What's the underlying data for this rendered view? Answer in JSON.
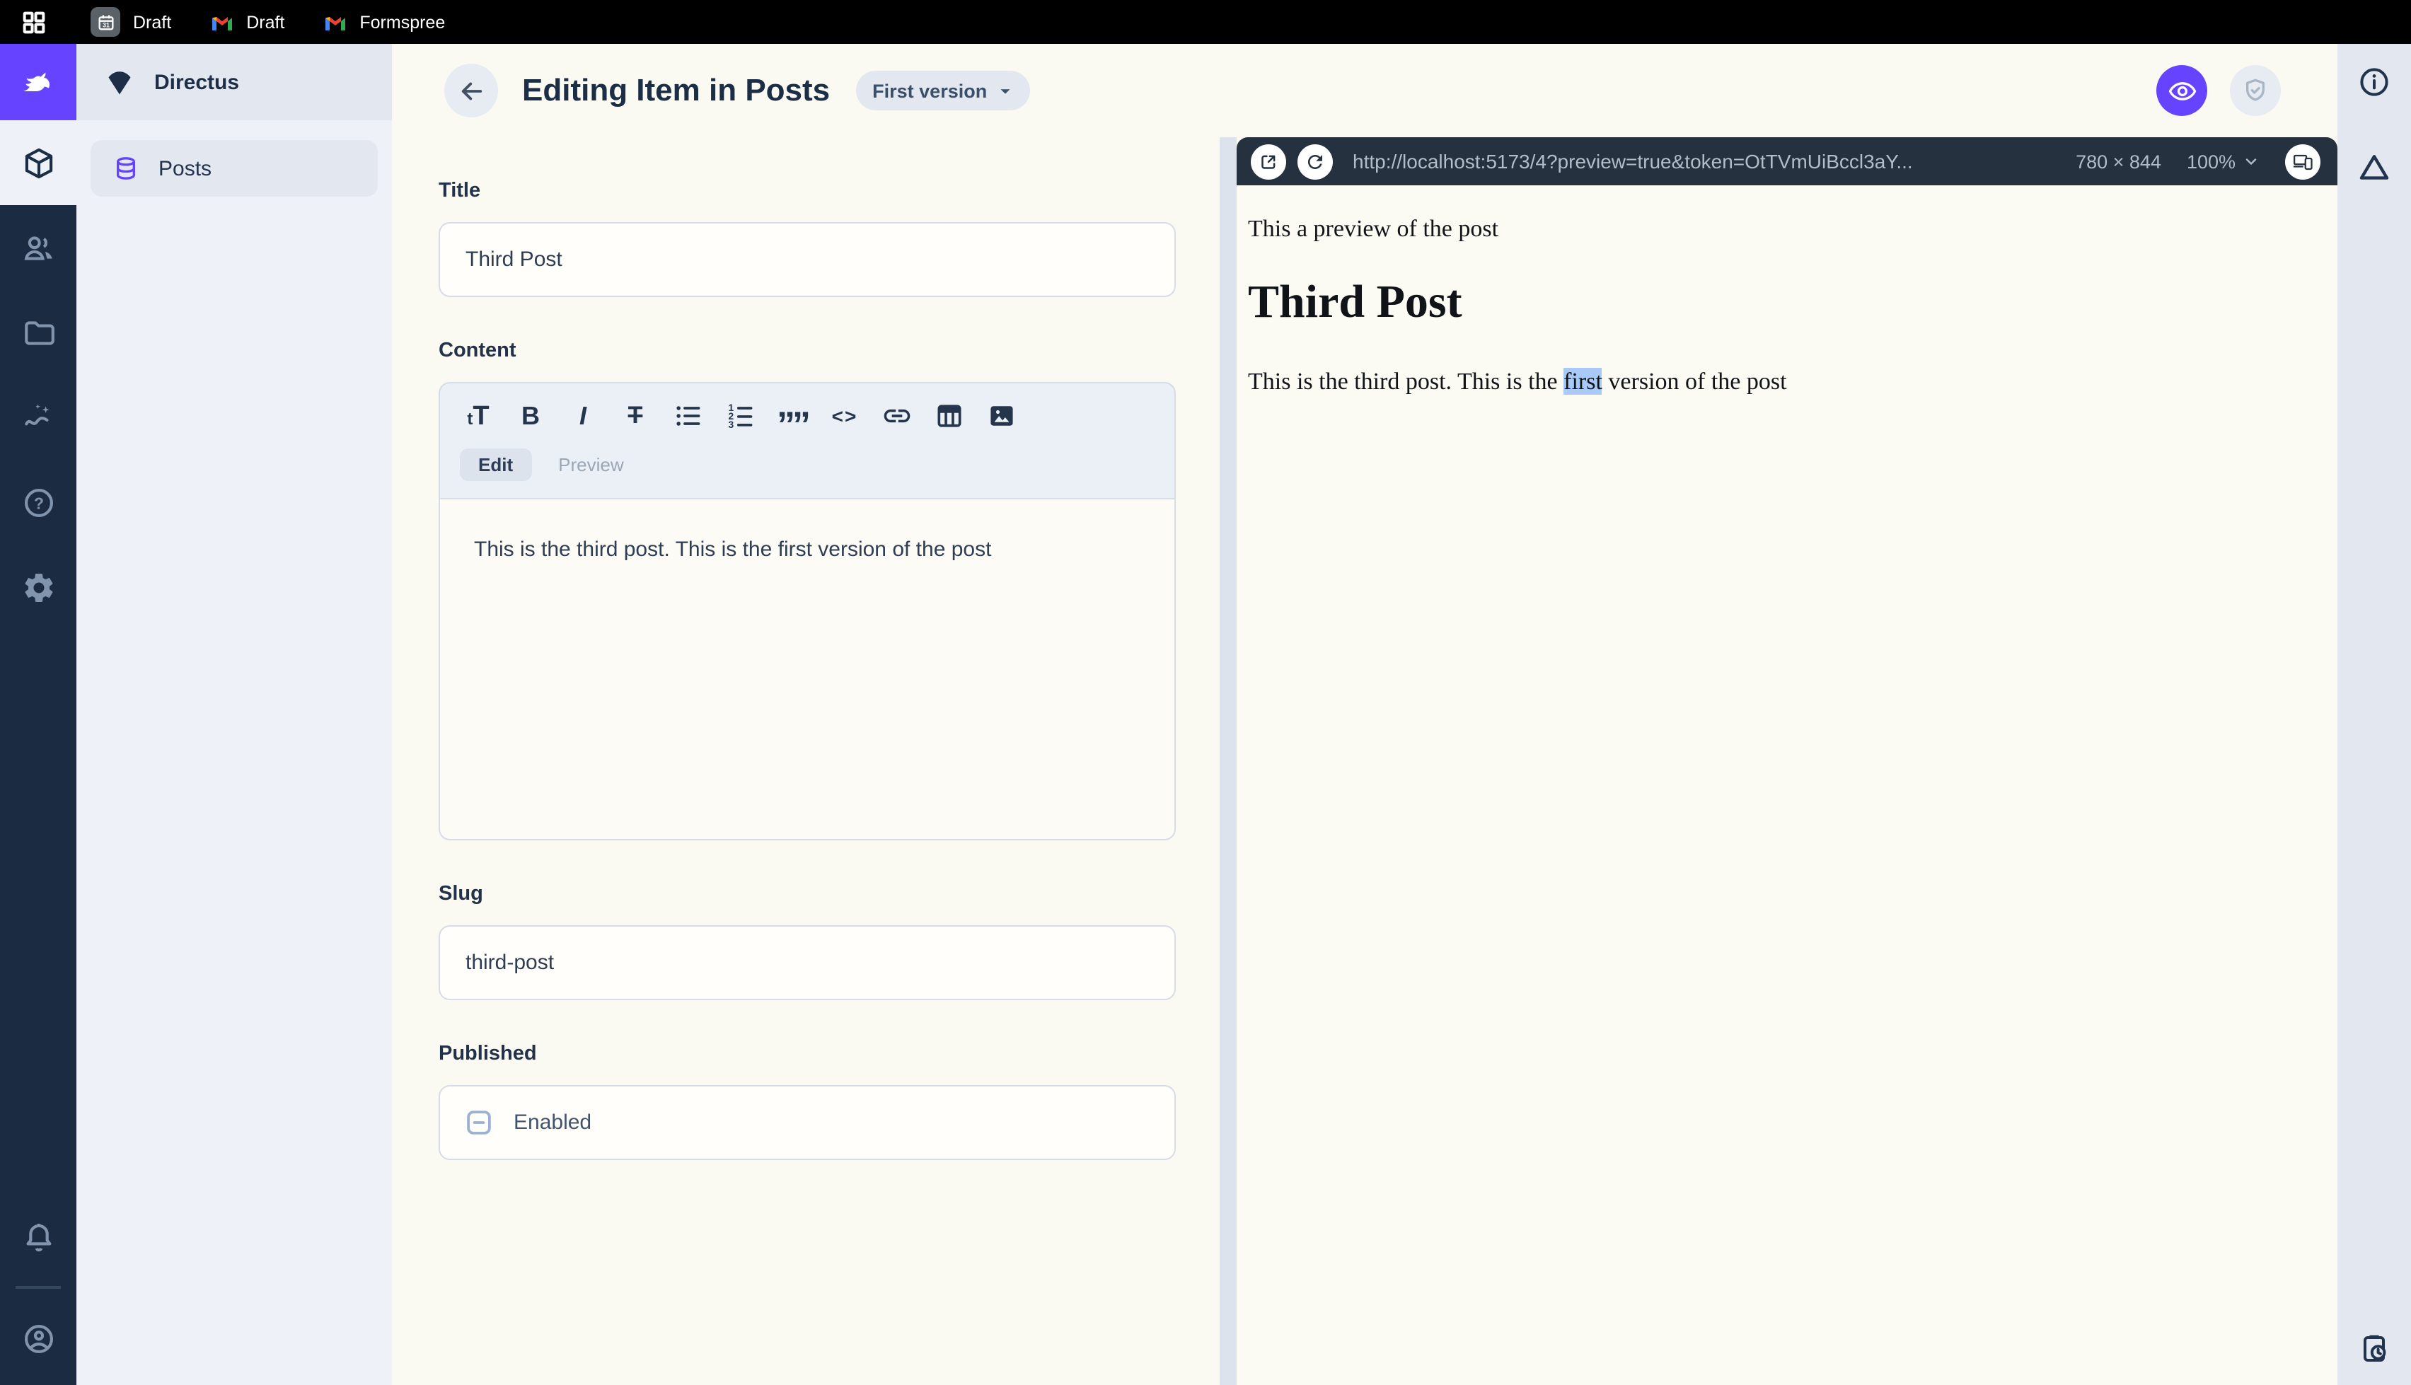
{
  "browser": {
    "tabs": [
      {
        "icon": "calendar-favicon",
        "label": "Draft"
      },
      {
        "icon": "gmail-favicon",
        "label": "Draft"
      },
      {
        "icon": "gmail-favicon",
        "label": "Formspree"
      }
    ]
  },
  "module_bar": {
    "active_module": "content",
    "modules": [
      "content",
      "users",
      "files",
      "insights",
      "help",
      "settings"
    ],
    "bottom": [
      "notifications",
      "account"
    ]
  },
  "nav": {
    "project_name": "Directus",
    "items": [
      {
        "label": "Posts"
      }
    ]
  },
  "header": {
    "title": "Editing Item in Posts",
    "version_pill": "First version"
  },
  "form": {
    "title": {
      "label": "Title",
      "value": "Third Post"
    },
    "content": {
      "label": "Content",
      "tabs": {
        "edit": "Edit",
        "preview": "Preview"
      },
      "value": "This is the third post. This is the first version of the post"
    },
    "slug": {
      "label": "Slug",
      "value": "third-post"
    },
    "published": {
      "label": "Published",
      "checkbox_label": "Enabled",
      "checkbox_state": "indeterminate"
    }
  },
  "editor_toolbar": {
    "glyphs": {
      "heading": "tT",
      "bold": "B",
      "italic": "I",
      "strikethrough": "T",
      "blockquote": "””",
      "code": "<>"
    }
  },
  "preview": {
    "url": "http://localhost:5173/4?preview=true&token=OtTVmUiBccl3aY...",
    "dimensions": "780 × 844",
    "zoom": "100%",
    "content": {
      "intro": "This a preview of the post",
      "heading": "Third Post",
      "body_before": "This is the third post. This is the ",
      "body_highlight": "first",
      "body_after": " version of the post"
    }
  },
  "colors": {
    "accent": "#6644ff",
    "selection_highlight": "#a9c9f7"
  }
}
